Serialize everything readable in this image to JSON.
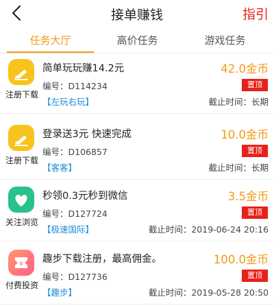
{
  "header": {
    "title": "接单赚钱",
    "guide_label": "指引"
  },
  "tabs": [
    {
      "label": "任务大厅",
      "active": true
    },
    {
      "label": "高价任务",
      "active": false
    },
    {
      "label": "游戏任务",
      "active": false
    }
  ],
  "colors": {
    "accent": "#f39a17",
    "link": "#1e8ad6",
    "red": "#e8201a",
    "yellow_icon": "#f8c31c",
    "green_icon": "#27c38a",
    "pink_icon": "#ff6f80"
  },
  "tasks": [
    {
      "icon": "pencil-icon",
      "category": "注册下载",
      "name": "简单玩玩赚14.2元",
      "code": "编号：D114234",
      "tag": "【左玩右玩】",
      "price": "42.0金币",
      "pin_label": "置顶",
      "deadline": "截止时间：长期"
    },
    {
      "icon": "pencil-icon",
      "category": "注册下载",
      "name": "登录送3元 快速完成",
      "code": "编号：D106857",
      "tag": "【客客】",
      "price": "10.0金币",
      "pin_label": "置顶",
      "deadline": "截止时间：长期"
    },
    {
      "icon": "heart-icon",
      "category": "关注浏览",
      "name": "秒领0.3元秒到微信",
      "code": "编号：D127724",
      "tag": "【极速国际】",
      "price": "3.5金币",
      "pin_label": "置顶",
      "deadline": "截止时间：2019-06-24 20:16"
    },
    {
      "icon": "coupon-icon",
      "category": "付费投资",
      "name": "趣步下载注册，最高佣金。",
      "code": "编号：D127736",
      "tag": "【趣步】",
      "price": "100.0金币",
      "pin_label": "置顶",
      "deadline": "截止时间：2019-05-28 20:50"
    }
  ]
}
